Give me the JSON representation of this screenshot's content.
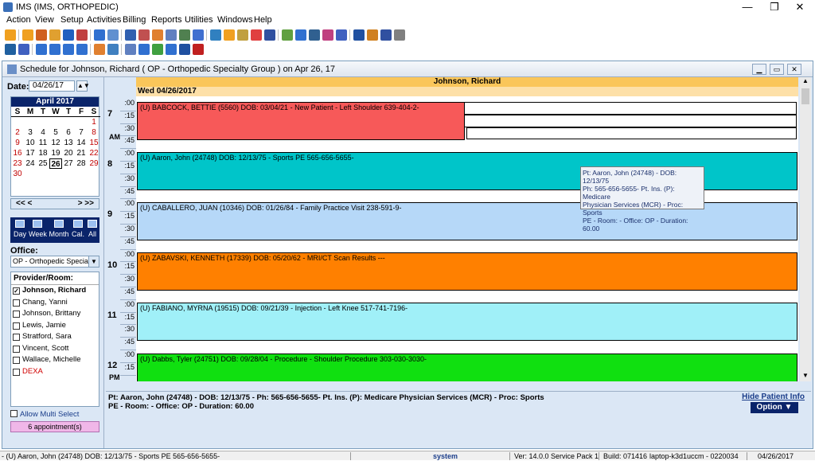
{
  "window": {
    "title": "IMS (IMS, ORTHOPEDIC)",
    "minimize": "—",
    "restore": "❐",
    "close": "✕"
  },
  "menu": [
    "Action",
    "View",
    "Setup",
    "Activities",
    "Billing",
    "Reports",
    "Utilities",
    "Windows",
    "Help"
  ],
  "schedule_window": {
    "title": "Schedule for Johnson, Richard ( OP - Orthopedic Specialty Group )  on  Apr 26, 17"
  },
  "left": {
    "date_label": "Date:",
    "date_value": "04/26/17",
    "calendar": {
      "month_title": "April 2017",
      "days_of_week": [
        "S",
        "M",
        "T",
        "W",
        "T",
        "F",
        "S"
      ],
      "weeks": [
        [
          "",
          "",
          "",
          "",
          "",
          "",
          "1"
        ],
        [
          "2",
          "3",
          "4",
          "5",
          "6",
          "7",
          "8"
        ],
        [
          "9",
          "10",
          "11",
          "12",
          "13",
          "14",
          "15"
        ],
        [
          "16",
          "17",
          "18",
          "19",
          "20",
          "21",
          "22"
        ],
        [
          "23",
          "24",
          "25",
          "26",
          "27",
          "28",
          "29"
        ],
        [
          "30",
          "",
          "",
          "",
          "",
          "",
          ""
        ]
      ],
      "selected_day": "26",
      "nav_prev": "<< <",
      "nav_next": "> >>"
    },
    "views": [
      "Day",
      "Week",
      "Month",
      "Cal.",
      "All"
    ],
    "office_label": "Office:",
    "office_value": "OP - Orthopedic Specialty",
    "provider_header": "Provider/Room:",
    "providers": [
      {
        "name": "Johnson, Richard",
        "checked": true
      },
      {
        "name": "Chang, Yanni",
        "checked": false
      },
      {
        "name": "Johnson, Brittany",
        "checked": false
      },
      {
        "name": "Lewis, Jamie",
        "checked": false
      },
      {
        "name": "Stratford, Sara",
        "checked": false
      },
      {
        "name": "Vincent, Scott",
        "checked": false
      },
      {
        "name": "Wallace, Michelle",
        "checked": false
      },
      {
        "name": "DEXA",
        "checked": false,
        "color": "#d00000"
      }
    ],
    "allow_multi": "Allow Multi Select",
    "appointment_count": "6 appointment(s)"
  },
  "schedule": {
    "provider": "Johnson, Richard",
    "date": "Wed 04/26/2017",
    "time_labels": {
      "hours": [
        "7",
        "8",
        "9",
        "10",
        "11",
        "12"
      ],
      "am": "AM",
      "pm": "PM",
      "minutes": [
        ":00",
        ":15",
        ":30",
        ":45"
      ]
    },
    "appointments": [
      {
        "text": "(U)  BABCOCK, BETTIE  (5560)  DOB: 03/04/21 -  New Patient - Left Shoulder      639-404-2-",
        "color": "#f75959"
      },
      {
        "text": "(U)  Aaron, John  (24748)  DOB: 12/13/75 -  Sports PE      565-656-5655-",
        "color": "#00c5c9"
      },
      {
        "text": "(U)  CABALLERO, JUAN  (10346)  DOB: 01/26/84 -  Family Practice Visit      238-591-9-",
        "color": "#b6d8f8"
      },
      {
        "text": "(U)  ZABAVSKI, KENNETH  (17339)  DOB: 05/20/62 -  MRI/CT Scan Results      ---",
        "color": "#ff8000"
      },
      {
        "text": "(U)  FABIANO, MYRNA  (19515)  DOB: 09/21/39 -  Injection - Left Knee      517-741-7196-",
        "color": "#a0f0f8"
      },
      {
        "text": "(U)  Dabbs, Tyler  (24751)  DOB: 09/28/04 -  Procedure - Shoulder Procedure      303-030-3030-",
        "color": "#10e010"
      }
    ],
    "tooltip": [
      "Pt: Aaron, John  (24748) - DOB: 12/13/75",
      "Ph: 565-656-5655- Pt. Ins. (P): Medicare",
      "Physician Services (MCR)  - Proc: Sports",
      "PE  - Room:    - Office: OP  - Duration: 60.00"
    ]
  },
  "info": {
    "line1": "Pt: Aaron, John  (24748) - DOB: 12/13/75 - Ph: 565-656-5655- Pt. Ins. (P): Medicare Physician Services (MCR)  - Proc: Sports",
    "line2": "PE  - Room:   - Office: OP  - Duration: 60.00",
    "hide_link": "Hide Patient Info",
    "option_button": "Option ▼"
  },
  "status": {
    "left": "- (U)  Aaron, John  (24748)  DOB: 12/13/75 -  Sports PE      565-656-5655-",
    "user": "system",
    "version": "Ver: 14.0.0 Service Pack 1",
    "build": "Build: 071416",
    "machine": "laptop-k3d1uccm - 0220034",
    "date": "04/26/2017"
  },
  "colors": {
    "accent": "#0a246a",
    "provider_header": "#fac65a",
    "date_header": "#fde0a8"
  }
}
